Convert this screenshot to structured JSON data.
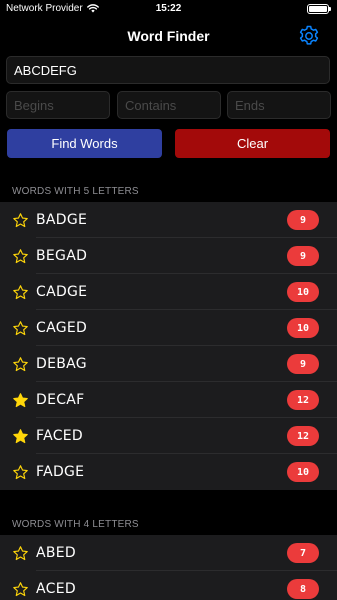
{
  "status_bar": {
    "carrier": "Network Provider",
    "time": "15:22",
    "battery_level": 1.0
  },
  "nav": {
    "title": "Word Finder",
    "settings_icon": "gear-icon"
  },
  "search": {
    "value": "ABCDEFG",
    "begins_placeholder": "Begins",
    "contains_placeholder": "Contains",
    "ends_placeholder": "Ends"
  },
  "buttons": {
    "find_label": "Find Words",
    "clear_label": "Clear"
  },
  "colors": {
    "accent": "#0a84ff",
    "find_button": "#2f3fa0",
    "clear_button": "#a30a0a",
    "badge": "#eb3b3b",
    "star": "#ffd60a"
  },
  "sections": [
    {
      "header": "WORDS WITH 5 LETTERS",
      "words": [
        {
          "word": "BADGE",
          "score": "9",
          "favorite": false
        },
        {
          "word": "BEGAD",
          "score": "9",
          "favorite": false
        },
        {
          "word": "CADGE",
          "score": "10",
          "favorite": false
        },
        {
          "word": "CAGED",
          "score": "10",
          "favorite": false
        },
        {
          "word": "DEBAG",
          "score": "9",
          "favorite": false
        },
        {
          "word": "DECAF",
          "score": "12",
          "favorite": true
        },
        {
          "word": "FACED",
          "score": "12",
          "favorite": true
        },
        {
          "word": "FADGE",
          "score": "10",
          "favorite": false
        }
      ]
    },
    {
      "header": "WORDS WITH 4 LETTERS",
      "words": [
        {
          "word": "ABED",
          "score": "7",
          "favorite": false
        },
        {
          "word": "ACED",
          "score": "8",
          "favorite": false
        }
      ]
    }
  ]
}
